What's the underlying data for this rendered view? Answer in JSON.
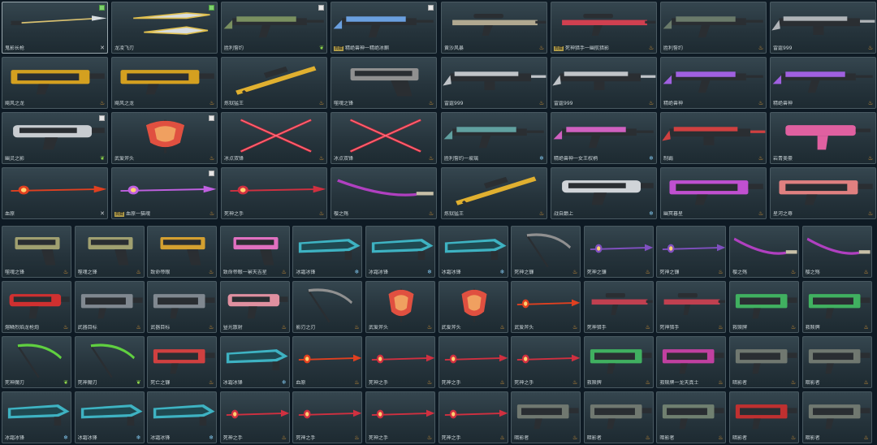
{
  "colors": {
    "background": "#0e1a24",
    "tile": "#2c3b43",
    "tile_border": "#4a5a62",
    "text": "#c9d2d6",
    "flame": "#e8a13a",
    "snow": "#7fc2e8",
    "shield": "#c8ccd0",
    "leaf": "#8fd84a",
    "badge": "#b8a24a"
  },
  "top_panel": {
    "items": [
      {
        "name": "鬼影长枪",
        "badge": "",
        "icon": "shield-icon",
        "check": "green",
        "weapon": "spear",
        "accent": "#d8c070"
      },
      {
        "name": "龙凌飞刃",
        "badge": "",
        "icon": "",
        "check": "green",
        "weapon": "knives",
        "accent": "#e0c050"
      },
      {
        "name": "胜利誓约",
        "badge": "",
        "icon": "leaf-icon",
        "check": "white",
        "weapon": "rifle",
        "accent": "#7a9060"
      },
      {
        "name": "精绝兽神一精绝冰麒",
        "badge": "典藏",
        "icon": "",
        "check": "white",
        "weapon": "rifle",
        "accent": "#6aa0e0"
      },
      {
        "name": "黄沙风暴",
        "badge": "",
        "icon": "flame-icon",
        "check": "",
        "weapon": "sniper",
        "accent": "#b0a890"
      },
      {
        "name": "死神猎手一幽航猎影",
        "badge": "典藏",
        "icon": "flame-icon",
        "check": "",
        "weapon": "sniper",
        "accent": "#d04050"
      },
      {
        "name": "胜利誓约",
        "badge": "",
        "icon": "flame-icon",
        "check": "",
        "weapon": "rifle",
        "accent": "#6a7a6a"
      },
      {
        "name": "雷霆999",
        "badge": "",
        "icon": "flame-icon",
        "check": "",
        "weapon": "mg",
        "accent": "#b0b4b8"
      },
      {
        "name": "飓风之龙",
        "badge": "",
        "icon": "flame-icon",
        "check": "",
        "weapon": "heavy",
        "accent": "#d4a020"
      },
      {
        "name": "飓风之龙",
        "badge": "",
        "icon": "flame-icon",
        "check": "",
        "weapon": "heavy",
        "accent": "#d4a020"
      },
      {
        "name": "炼狱猛王",
        "badge": "",
        "icon": "flame-icon",
        "check": "",
        "weapon": "gold-sniper",
        "accent": "#e0b030"
      },
      {
        "name": "噬魂之锋",
        "badge": "",
        "icon": "flame-icon",
        "check": "",
        "weapon": "pistol",
        "accent": "#909090"
      },
      {
        "name": "雷霆999",
        "badge": "",
        "icon": "flame-icon",
        "check": "",
        "weapon": "mg",
        "accent": "#c0c4c8"
      },
      {
        "name": "雷霆999",
        "badge": "",
        "icon": "flame-icon",
        "check": "",
        "weapon": "mg",
        "accent": "#c0c4c8"
      },
      {
        "name": "精绝兽神",
        "badge": "",
        "icon": "flame-icon",
        "check": "",
        "weapon": "rifle",
        "accent": "#a060e0"
      },
      {
        "name": "精绝兽神",
        "badge": "",
        "icon": "flame-icon",
        "check": "",
        "weapon": "rifle",
        "accent": "#a060e0"
      },
      {
        "name": "幽灵之影",
        "badge": "",
        "icon": "leaf-icon",
        "check": "white",
        "weapon": "cannon",
        "accent": "#c8ccd0"
      },
      {
        "name": "武爱斧头",
        "badge": "",
        "icon": "flame-icon",
        "check": "white",
        "weapon": "axe",
        "accent": "#e05040"
      },
      {
        "name": "冰点双锋",
        "badge": "",
        "icon": "flame-icon",
        "check": "",
        "weapon": "xblades",
        "accent": "#e03040"
      },
      {
        "name": "冰点双锋",
        "badge": "",
        "icon": "flame-icon",
        "check": "",
        "weapon": "xblades",
        "accent": "#e03040"
      },
      {
        "name": "胜利誓约一玻璃",
        "badge": "",
        "icon": "snow-icon",
        "check": "",
        "weapon": "rifle",
        "accent": "#60a0a0"
      },
      {
        "name": "精绝兽神一女王权柄",
        "badge": "",
        "icon": "snow-icon",
        "check": "",
        "weapon": "rifle",
        "accent": "#d060c0"
      },
      {
        "name": "制霸",
        "badge": "",
        "icon": "flame-icon",
        "check": "",
        "weapon": "mg",
        "accent": "#d04040"
      },
      {
        "name": "岩青美豪",
        "badge": "",
        "icon": "flame-icon",
        "check": "",
        "weapon": "smg",
        "accent": "#e060a0"
      },
      {
        "name": "血原",
        "badge": "",
        "icon": "shield-icon",
        "check": "",
        "weapon": "staff",
        "accent": "#e04020"
      },
      {
        "name": "血原一猫魂",
        "badge": "典藏",
        "icon": "flame-icon",
        "check": "white",
        "weapon": "staff",
        "accent": "#c060e0"
      },
      {
        "name": "死神之手",
        "badge": "",
        "icon": "flame-icon",
        "check": "",
        "weapon": "staff",
        "accent": "#d03040"
      },
      {
        "name": "樱之殇",
        "badge": "",
        "icon": "flame-icon",
        "check": "",
        "weapon": "katana",
        "accent": "#b040c0"
      },
      {
        "name": "炼狱猛王",
        "badge": "",
        "icon": "flame-icon",
        "check": "",
        "weapon": "gold-sniper",
        "accent": "#e0b030"
      },
      {
        "name": "战自巅上",
        "badge": "",
        "icon": "snow-icon",
        "check": "",
        "weapon": "cannon",
        "accent": "#d0d4d8"
      },
      {
        "name": "幽冥暮星",
        "badge": "",
        "icon": "flame-icon",
        "check": "",
        "weapon": "heavy",
        "accent": "#c050d0"
      },
      {
        "name": "星河之尊",
        "badge": "",
        "icon": "flame-icon",
        "check": "",
        "weapon": "heavy",
        "accent": "#e08080"
      }
    ]
  },
  "bottom_panel": {
    "items": [
      {
        "name": "噬魂之锋",
        "icon": "flame-icon",
        "weapon": "pistol",
        "accent": "#a0a070"
      },
      {
        "name": "噬魂之锋",
        "icon": "flame-icon",
        "weapon": "pistol",
        "accent": "#a0a070"
      },
      {
        "name": "致命帝眼",
        "icon": "flame-icon",
        "weapon": "pistol",
        "accent": "#d4a030"
      },
      {
        "name": "致命帝眼一幂天吉星",
        "icon": "flame-icon",
        "weapon": "pistol",
        "accent": "#e070c0"
      },
      {
        "name": "冰霜冰锋",
        "icon": "snow-icon",
        "weapon": "blade",
        "accent": "#40c0d0"
      },
      {
        "name": "冰霜冰锋",
        "icon": "snow-icon",
        "weapon": "blade",
        "accent": "#40c0d0"
      },
      {
        "name": "冰霜冰锋",
        "icon": "snow-icon",
        "weapon": "blade",
        "accent": "#40c0d0"
      },
      {
        "name": "死神之镰",
        "icon": "flame-icon",
        "weapon": "scythe",
        "accent": "#909090"
      },
      {
        "name": "死神之镰",
        "icon": "flame-icon",
        "weapon": "staff",
        "accent": "#8050c0"
      },
      {
        "name": "死神之镰",
        "icon": "flame-icon",
        "weapon": "staff",
        "accent": "#8050c0"
      },
      {
        "name": "樱之殇",
        "icon": "flame-icon",
        "weapon": "katana",
        "accent": "#b040c0"
      },
      {
        "name": "樱之殇",
        "icon": "flame-icon",
        "weapon": "katana",
        "accent": "#b040c0"
      },
      {
        "name": "熔鳞烈焰龙枪炮",
        "icon": "flame-icon",
        "weapon": "cannon",
        "accent": "#d03030"
      },
      {
        "name": "武器目标",
        "icon": "flame-icon",
        "weapon": "heavy",
        "accent": "#808890"
      },
      {
        "name": "武器目标",
        "icon": "flame-icon",
        "weapon": "heavy",
        "accent": "#808890"
      },
      {
        "name": "昼光散射",
        "icon": "flame-icon",
        "weapon": "cannon",
        "accent": "#e090a0"
      },
      {
        "name": "影刃之刃",
        "icon": "flame-icon",
        "weapon": "scythe",
        "accent": "#909090"
      },
      {
        "name": "武爱斧头",
        "icon": "flame-icon",
        "weapon": "axe",
        "accent": "#e05040"
      },
      {
        "name": "武爱斧头",
        "icon": "flame-icon",
        "weapon": "axe",
        "accent": "#e05040"
      },
      {
        "name": "武爱斧头",
        "icon": "flame-icon",
        "weapon": "staff",
        "accent": "#e04020"
      },
      {
        "name": "死神猎手",
        "icon": "flame-icon",
        "weapon": "sniper",
        "accent": "#c04050"
      },
      {
        "name": "死神猎手",
        "icon": "flame-icon",
        "weapon": "sniper",
        "accent": "#c04050"
      },
      {
        "name": "救赎牌",
        "icon": "flame-icon",
        "weapon": "heavy",
        "accent": "#40b060"
      },
      {
        "name": "救赎牌",
        "icon": "flame-icon",
        "weapon": "heavy",
        "accent": "#40b060"
      },
      {
        "name": "死神魔刃",
        "icon": "leaf-icon",
        "weapon": "scythe",
        "accent": "#60d040"
      },
      {
        "name": "死神魔刃",
        "icon": "leaf-icon",
        "weapon": "scythe",
        "accent": "#60d040"
      },
      {
        "name": "死亡之镰",
        "icon": "flame-icon",
        "weapon": "heavy",
        "accent": "#d04040"
      },
      {
        "name": "冰霜冰锋",
        "icon": "snow-icon",
        "weapon": "blade",
        "accent": "#40c0d0"
      },
      {
        "name": "血原",
        "icon": "flame-icon",
        "weapon": "staff",
        "accent": "#e04020"
      },
      {
        "name": "死神之手",
        "icon": "flame-icon",
        "weapon": "staff",
        "accent": "#d03040"
      },
      {
        "name": "死神之手",
        "icon": "flame-icon",
        "weapon": "staff",
        "accent": "#d03040"
      },
      {
        "name": "死神之手",
        "icon": "flame-icon",
        "weapon": "staff",
        "accent": "#d03040"
      },
      {
        "name": "救赎牌",
        "icon": "flame-icon",
        "weapon": "heavy",
        "accent": "#40b060"
      },
      {
        "name": "救赎牌一龙天真士",
        "icon": "flame-icon",
        "weapon": "heavy",
        "accent": "#c040a0"
      },
      {
        "name": "暗影者",
        "icon": "flame-icon",
        "weapon": "heavy",
        "accent": "#707870"
      },
      {
        "name": "暗影者",
        "icon": "flame-icon",
        "weapon": "heavy",
        "accent": "#707870"
      },
      {
        "name": "冰霜冰锋",
        "icon": "snow-icon",
        "weapon": "blade",
        "accent": "#40c0d0"
      },
      {
        "name": "冰霜冰锋",
        "icon": "snow-icon",
        "weapon": "blade",
        "accent": "#40c0d0"
      },
      {
        "name": "冰霜冰锋",
        "icon": "snow-icon",
        "weapon": "blade",
        "accent": "#40c0d0"
      },
      {
        "name": "死神之手",
        "icon": "flame-icon",
        "weapon": "staff",
        "accent": "#d03040"
      },
      {
        "name": "死神之手",
        "icon": "flame-icon",
        "weapon": "staff",
        "accent": "#d03040"
      },
      {
        "name": "死神之手",
        "icon": "flame-icon",
        "weapon": "staff",
        "accent": "#d03040"
      },
      {
        "name": "死神之手",
        "icon": "flame-icon",
        "weapon": "staff",
        "accent": "#d03040"
      },
      {
        "name": "暗影者",
        "icon": "flame-icon",
        "weapon": "heavy",
        "accent": "#707870"
      },
      {
        "name": "暗影者",
        "icon": "flame-icon",
        "weapon": "heavy",
        "accent": "#707870"
      },
      {
        "name": "暗影者",
        "icon": "flame-icon",
        "weapon": "heavy",
        "accent": "#708070"
      },
      {
        "name": "暗影者",
        "icon": "flame-icon",
        "weapon": "heavy",
        "accent": "#c03030"
      },
      {
        "name": "暗影者",
        "icon": "flame-icon",
        "weapon": "heavy",
        "accent": "#707870"
      }
    ]
  }
}
